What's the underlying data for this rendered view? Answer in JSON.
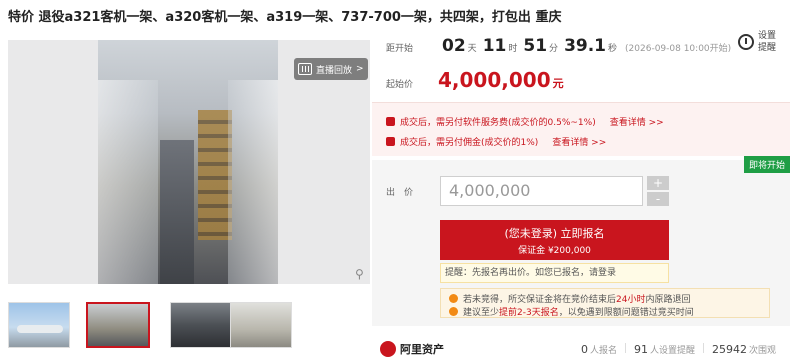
{
  "title": "特价 退役a321客机一架、a320客机一架、a319一架、737-700一架，共四架，打包出 重庆",
  "gallery": {
    "live_button": "直播回放",
    "live_arrow": ">"
  },
  "countdown": {
    "label": "距开始",
    "days": "02",
    "days_unit": "天",
    "hours": "11",
    "hours_unit": "时",
    "minutes": "51",
    "minutes_unit": "分",
    "seconds": "39.1",
    "seconds_unit": "秒",
    "start_time": "(2026-09-08 10:00开始)"
  },
  "remind": {
    "label": "设置提醒"
  },
  "start_price": {
    "label": "起始价",
    "value": "4,000,000",
    "unit": "元"
  },
  "fees": [
    {
      "text": "成交后，需另付软件服务费(成交价的0.5%~1%)",
      "link": "查看详情 >>"
    },
    {
      "text": "成交后，需另付佣金(成交价的1%)",
      "link": "查看详情 >>"
    }
  ],
  "badge": "即将开始",
  "bid": {
    "label": "出　价",
    "value": "4,000,000",
    "plus": "+",
    "minus": "-",
    "signup_title": "(您未登录) 立即报名",
    "signup_deposit": "保证金 ¥200,000",
    "tip": "提醒：先报名再出价。如您已报名，请登录"
  },
  "notes": {
    "n1_prefix": "若未竞得，所交保证金将在竞价结束后",
    "n1_highlight": "24小时",
    "n1_suffix": "内原路退回",
    "n2_prefix": "建议至少",
    "n2_highlight": "提前2-3天报名",
    "n2_suffix": "，以免遇到限额问题错过竞买时间"
  },
  "footer": {
    "brand": "阿里资产",
    "signups": "0",
    "signups_label": "人报名",
    "reminders": "91",
    "reminders_label": "人设置提醒",
    "views": "25942",
    "views_label": "次围观"
  },
  "colors": {
    "accent": "#c9151e",
    "badge": "#1f9e45",
    "note_dot": "#f28a14"
  }
}
